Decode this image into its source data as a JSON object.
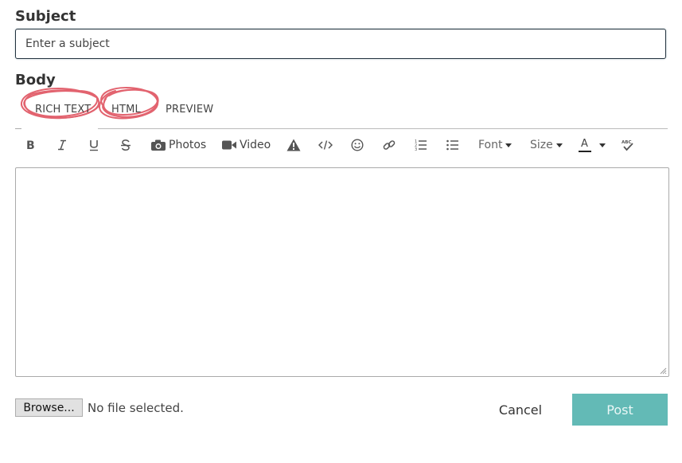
{
  "subject": {
    "label": "Subject",
    "placeholder": "Enter a subject",
    "value": ""
  },
  "body": {
    "label": "Body"
  },
  "tabs": [
    {
      "label": "RICH TEXT"
    },
    {
      "label": "HTML"
    },
    {
      "label": "PREVIEW"
    }
  ],
  "toolbar": {
    "bold_icon": "bold-icon",
    "italic_icon": "italic-icon",
    "underline_icon": "underline-icon",
    "strike_icon": "strikethrough-icon",
    "photos_label": "Photos",
    "video_label": "Video",
    "font_label": "Font",
    "size_label": "Size",
    "color_letter": "A"
  },
  "file": {
    "browse_label": "Browse...",
    "status": "No file selected."
  },
  "actions": {
    "cancel_label": "Cancel",
    "post_label": "Post"
  },
  "colors": {
    "accent": "#63bab6",
    "annotation": "#d9303f",
    "input_border": "#23323e"
  }
}
